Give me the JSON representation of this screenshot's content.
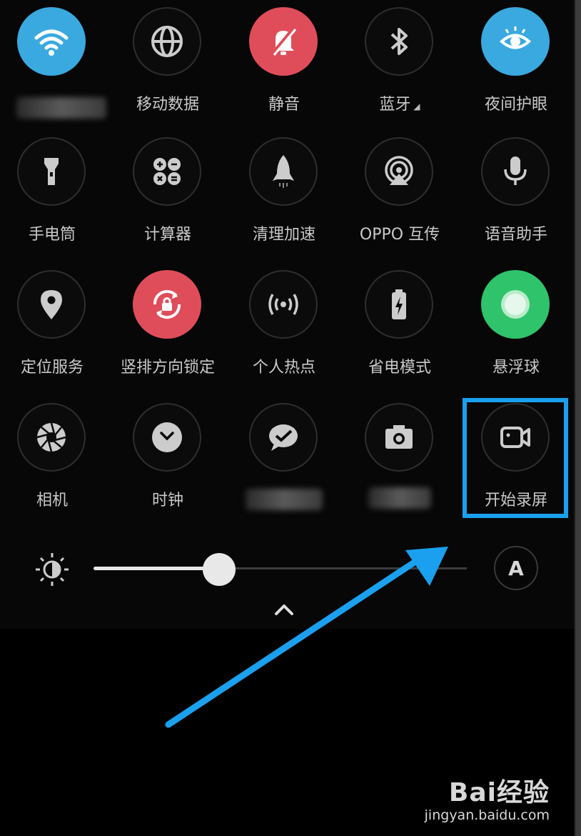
{
  "tiles": [
    {
      "label": "",
      "icon": "wifi-icon",
      "active": true,
      "color": "#39a9e0"
    },
    {
      "label": "移动数据",
      "icon": "globe-icon"
    },
    {
      "label": "静音",
      "icon": "bell-off-icon",
      "active": true,
      "color": "#e04d5a"
    },
    {
      "label": "蓝牙",
      "icon": "bluetooth-icon"
    },
    {
      "label": "夜间护眼",
      "icon": "eye-icon",
      "active": true,
      "color": "#39a9e0"
    },
    {
      "label": "手电筒",
      "icon": "flashlight-icon"
    },
    {
      "label": "计算器",
      "icon": "calculator-icon"
    },
    {
      "label": "清理加速",
      "icon": "rocket-icon"
    },
    {
      "label": "OPPO 互传",
      "icon": "share-icon"
    },
    {
      "label": "语音助手",
      "icon": "microphone-icon"
    },
    {
      "label": "定位服务",
      "icon": "location-pin-icon"
    },
    {
      "label": "竖排方向锁定",
      "icon": "rotation-lock-icon",
      "active": true,
      "color": "#e04d5a"
    },
    {
      "label": "个人热点",
      "icon": "hotspot-icon"
    },
    {
      "label": "省电模式",
      "icon": "battery-icon"
    },
    {
      "label": "悬浮球",
      "icon": "floating-ball-icon",
      "active": true,
      "color": "#2fc36b"
    },
    {
      "label": "相机",
      "icon": "aperture-icon"
    },
    {
      "label": "时钟",
      "icon": "clock-icon"
    },
    {
      "label": "",
      "icon": "chat-icon"
    },
    {
      "label": "",
      "icon": "camera-icon"
    },
    {
      "label": "开始录屏",
      "icon": "video-camera-icon"
    }
  ],
  "brightness": {
    "level": 0.33,
    "auto_label": "A"
  },
  "watermark": {
    "logo": "Bai经验",
    "url": "jingyan.baidu.com"
  },
  "colors": {
    "highlight": "#1aa0ee",
    "arrow": "#1aa0ee"
  }
}
